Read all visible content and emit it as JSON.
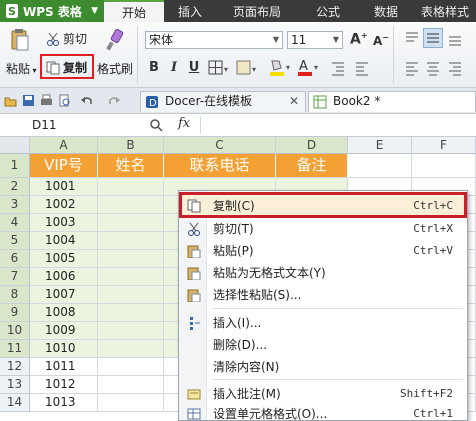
{
  "app": {
    "title": "WPS 表格"
  },
  "menubar": {
    "tabs": [
      "开始",
      "插入",
      "页面布局",
      "公式",
      "数据",
      "表格样式"
    ]
  },
  "ribbon": {
    "paste_label": "粘贴",
    "cut_label": "剪切",
    "copy_label": "复制",
    "format_painter_label": "格式刷",
    "font_name": "宋体",
    "font_size": "11",
    "bold": "B",
    "italic": "I",
    "underline": "U"
  },
  "doc_tabs": [
    {
      "label": "Docer-在线模板"
    },
    {
      "label": "Book2 *"
    }
  ],
  "formula_bar": {
    "cell_ref": "D11",
    "fx": "fx"
  },
  "columns": [
    "A",
    "B",
    "C",
    "D",
    "E",
    "F"
  ],
  "rows": [
    "1",
    "2",
    "3",
    "4",
    "5",
    "6",
    "7",
    "8",
    "9",
    "10",
    "11",
    "12",
    "13",
    "14"
  ],
  "header_row": [
    "VIP号",
    "姓名",
    "联系电话",
    "备注"
  ],
  "vip_numbers": [
    "1001",
    "1002",
    "1003",
    "1004",
    "1005",
    "1006",
    "1007",
    "1008",
    "1009",
    "1010",
    "1011",
    "1012",
    "1013"
  ],
  "context_menu": {
    "items": [
      {
        "label": "复制(C)",
        "shortcut": "Ctrl+C",
        "icon": "copy-icon"
      },
      {
        "label": "剪切(T)",
        "shortcut": "Ctrl+X",
        "icon": "scissors-icon"
      },
      {
        "label": "粘贴(P)",
        "shortcut": "Ctrl+V",
        "icon": "paste-icon"
      },
      {
        "label": "粘贴为无格式文本(Y)",
        "shortcut": "",
        "icon": "paste-text-icon"
      },
      {
        "label": "选择性粘贴(S)...",
        "shortcut": "",
        "icon": "paste-special-icon"
      },
      {
        "label": "插入(I)...",
        "shortcut": "",
        "icon": "insert-icon"
      },
      {
        "label": "删除(D)...",
        "shortcut": "",
        "icon": ""
      },
      {
        "label": "清除内容(N)",
        "shortcut": "",
        "icon": ""
      },
      {
        "label": "插入批注(M)",
        "shortcut": "Shift+F2",
        "icon": "comment-icon"
      },
      {
        "label": "设置单元格格式(O)...",
        "shortcut": "Ctrl+1",
        "icon": "format-cells-icon"
      }
    ]
  },
  "colors": {
    "header_orange": "#f3a134",
    "selection_green": "#eaf4df",
    "highlight_red": "#c8202a",
    "wps_green": "#3d8b2f"
  }
}
